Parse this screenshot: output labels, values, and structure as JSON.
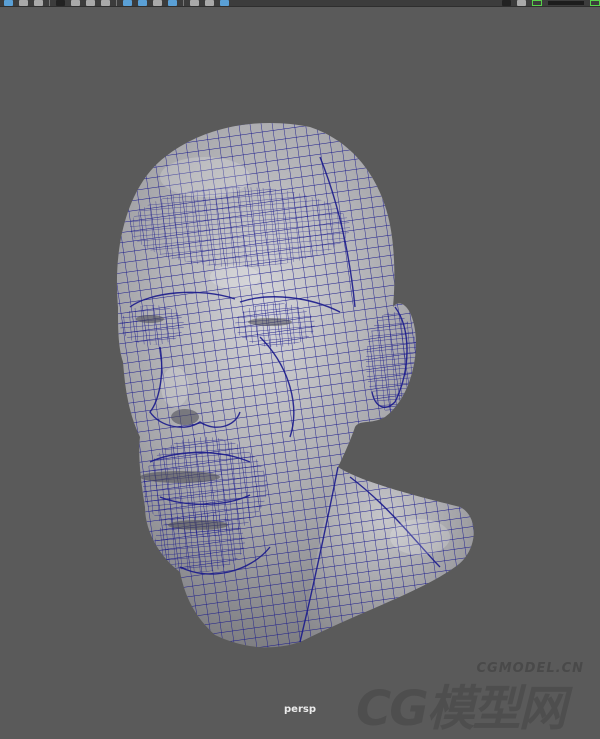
{
  "viewport": {
    "camera_label": "persp",
    "background_color": "#5a5a5a",
    "wireframe_color": "#1a1a8c",
    "mesh_color": "#a9a9ad"
  },
  "toolbar": {
    "icons": [
      "select-camera-icon",
      "camera-attr-icon",
      "bookmark-icon",
      "image-plane-icon",
      "grid-icon",
      "film-gate-icon",
      "resolution-gate-icon",
      "wireframe-icon",
      "smooth-shade-icon",
      "textured-icon",
      "lighting-icon",
      "shadows-icon",
      "xray-icon",
      "isolate-icon",
      "gamma-icon"
    ]
  },
  "watermark": {
    "brand_text": "CG模型网",
    "url_text": "CGMODEL.CN"
  }
}
